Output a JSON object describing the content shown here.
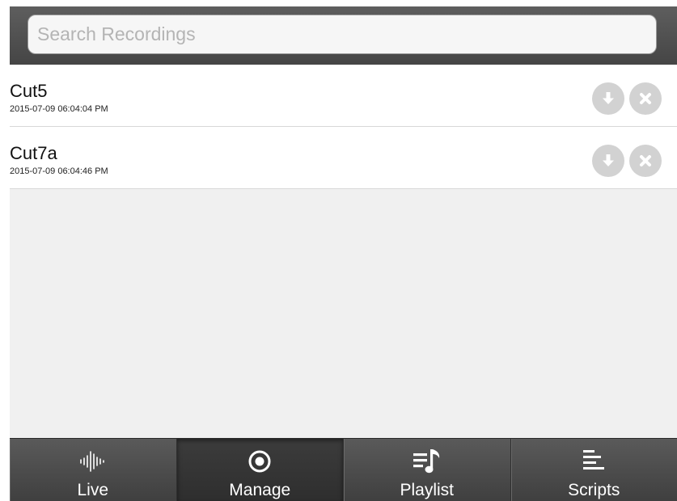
{
  "search": {
    "placeholder": "Search Recordings",
    "value": ""
  },
  "recordings": [
    {
      "name": "Cut5",
      "date": "2015-07-09 06:04:04 PM",
      "actions": [
        "download-icon",
        "delete-icon"
      ]
    },
    {
      "name": "Cut7a",
      "date": "2015-07-09 06:04:46 PM",
      "actions": [
        "download-icon",
        "delete-icon"
      ]
    }
  ],
  "tabs": [
    {
      "label": "Live",
      "icon": "waveform-icon",
      "active": false
    },
    {
      "label": "Manage",
      "icon": "target-icon",
      "active": true
    },
    {
      "label": "Playlist",
      "icon": "playlist-icon",
      "active": false
    },
    {
      "label": "Scripts",
      "icon": "scripts-icon",
      "active": false
    }
  ],
  "colors": {
    "header": "#4f4f4f",
    "background": "#f0f0f0",
    "row": "#ffffff",
    "action_button": "#d2d2d2",
    "tab_text": "#ffffff"
  }
}
